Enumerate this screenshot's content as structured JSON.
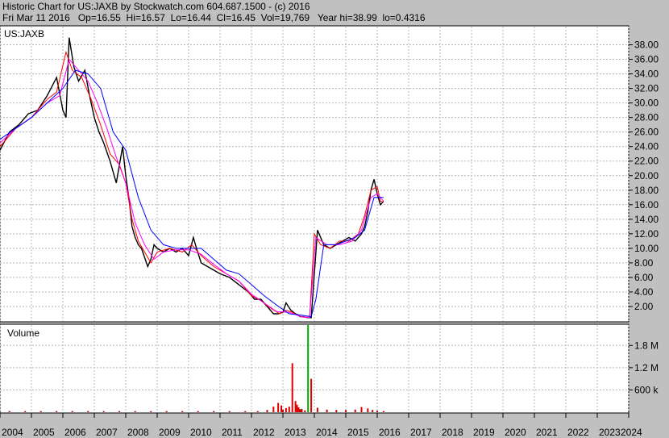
{
  "header": {
    "line1": "Historic Chart for US:JAXB by Stockwatch.com 604.687.1500 - (c) 2016",
    "line2": "Fri Mar 11 2016   Op=16.55  Hi=16.57  Lo=16.44  Cl=16.45  Vol=19,769   Year hi=38.99  lo=0.4316"
  },
  "chart_data": [
    {
      "type": "line",
      "label": "US:JAXB",
      "x_labels": [
        "2004",
        "2005",
        "2006",
        "2007",
        "2008",
        "2009",
        "2010",
        "2011",
        "2012",
        "2013",
        "2014",
        "2015",
        "2016",
        "2017",
        "2018",
        "2019",
        "2020",
        "2021",
        "2022",
        "2023",
        "2024"
      ],
      "y_ticks": [
        2,
        4,
        6,
        8,
        10,
        12,
        14,
        16,
        18,
        20,
        22,
        24,
        26,
        28,
        30,
        32,
        34,
        36,
        38
      ],
      "y_tick_labels": [
        "2.00",
        "4.00",
        "6.00",
        "8.00",
        "10.00",
        "12.00",
        "14.00",
        "16.00",
        "18.00",
        "20.00",
        "22.00",
        "24.00",
        "26.00",
        "28.00",
        "30.00",
        "32.00",
        "34.00",
        "36.00",
        "38.00"
      ],
      "ylim": [
        0,
        40.5
      ],
      "grid": true,
      "series": [
        {
          "color": "#000000",
          "x": [
            2004.0,
            2004.3,
            2004.6,
            2004.9,
            2005.2,
            2005.5,
            2005.8,
            2006.0,
            2006.1,
            2006.2,
            2006.35,
            2006.5,
            2006.7,
            2006.85,
            2007.0,
            2007.15,
            2007.3,
            2007.5,
            2007.7,
            2007.9,
            2008.0,
            2008.1,
            2008.2,
            2008.3,
            2008.4,
            2008.5,
            2008.7,
            2008.8,
            2008.9,
            2009.0,
            2009.2,
            2009.4,
            2009.6,
            2009.8,
            2010.0,
            2010.15,
            2010.25,
            2010.4,
            2010.6,
            2010.8,
            2011.0,
            2011.3,
            2011.6,
            2011.9,
            2012.1,
            2012.3,
            2012.5,
            2012.7,
            2012.85,
            2013.0,
            2013.1,
            2013.25,
            2013.4,
            2013.5,
            2013.55,
            2013.65,
            2013.75,
            2013.9,
            2014.1,
            2014.3,
            2014.5,
            2014.7,
            2014.9,
            2015.1,
            2015.3,
            2015.5,
            2015.6,
            2015.7,
            2015.8,
            2015.9,
            2016.0,
            2016.1,
            2016.2
          ],
          "y": [
            23.5,
            26.0,
            27.0,
            28.5,
            29.0,
            31.0,
            33.5,
            29.0,
            28.0,
            38.99,
            35.0,
            33.0,
            34.5,
            31.0,
            28.0,
            26.0,
            24.5,
            22.0,
            19.0,
            24.0,
            20.0,
            17.0,
            13.0,
            11.5,
            10.5,
            10.0,
            7.5,
            8.5,
            10.5,
            10.0,
            9.5,
            10.0,
            9.5,
            10.0,
            9.0,
            11.5,
            10.0,
            8.0,
            7.5,
            7.0,
            6.5,
            6.0,
            5.0,
            4.0,
            3.0,
            3.0,
            2.0,
            1.0,
            1.0,
            1.2,
            2.5,
            1.5,
            1.0,
            0.8,
            0.6,
            0.6,
            0.5,
            0.45,
            12.5,
            10.5,
            10.0,
            10.5,
            11.0,
            11.5,
            11.0,
            12.0,
            13.0,
            15.0,
            18.0,
            19.5,
            17.5,
            16.0,
            16.45
          ]
        },
        {
          "color": "#ff0000",
          "x": [
            2004.0,
            2004.5,
            2005.0,
            2005.5,
            2005.8,
            2006.1,
            2006.3,
            2006.6,
            2006.9,
            2007.2,
            2007.5,
            2007.8,
            2008.0,
            2008.2,
            2008.4,
            2008.6,
            2008.8,
            2009.0,
            2009.4,
            2009.8,
            2010.1,
            2010.4,
            2010.8,
            2011.2,
            2011.6,
            2012.0,
            2012.3,
            2012.6,
            2012.9,
            2013.1,
            2013.3,
            2013.5,
            2013.7,
            2013.85,
            2014.0,
            2014.2,
            2014.5,
            2014.8,
            2015.1,
            2015.4,
            2015.6,
            2015.8,
            2016.0,
            2016.1,
            2016.2
          ],
          "y": [
            24.0,
            26.5,
            28.0,
            30.5,
            31.5,
            37.0,
            34.5,
            33.5,
            30.5,
            27.0,
            23.0,
            21.5,
            19.0,
            14.0,
            11.0,
            9.5,
            8.0,
            9.5,
            10.0,
            9.5,
            10.5,
            9.0,
            7.5,
            6.5,
            5.5,
            3.5,
            2.8,
            1.8,
            1.0,
            1.5,
            1.2,
            0.7,
            0.5,
            0.5,
            12.0,
            10.5,
            10.0,
            11.0,
            11.0,
            12.0,
            14.5,
            18.0,
            18.5,
            16.5,
            16.4
          ]
        },
        {
          "color": "#ff00ff",
          "x": [
            2004.0,
            2004.5,
            2005.0,
            2005.5,
            2005.9,
            2006.2,
            2006.5,
            2006.8,
            2007.1,
            2007.4,
            2007.7,
            2008.0,
            2008.3,
            2008.6,
            2008.9,
            2009.2,
            2009.6,
            2010.0,
            2010.4,
            2010.8,
            2011.2,
            2011.6,
            2012.0,
            2012.4,
            2012.8,
            2013.2,
            2013.6,
            2013.85,
            2014.05,
            2014.4,
            2014.8,
            2015.2,
            2015.5,
            2015.8,
            2016.0,
            2016.2
          ],
          "y": [
            24.5,
            26.5,
            28.0,
            30.0,
            31.0,
            36.0,
            34.5,
            33.0,
            30.0,
            26.5,
            22.5,
            19.0,
            13.5,
            10.5,
            8.5,
            9.5,
            9.8,
            9.8,
            9.2,
            7.8,
            6.5,
            5.5,
            3.7,
            2.5,
            1.3,
            1.2,
            0.6,
            0.5,
            11.5,
            10.5,
            10.5,
            11.0,
            12.5,
            17.0,
            17.5,
            16.5
          ]
        },
        {
          "color": "#0000ff",
          "x": [
            2004.0,
            2004.5,
            2005.0,
            2005.5,
            2006.0,
            2006.4,
            2006.8,
            2007.2,
            2007.6,
            2008.0,
            2008.4,
            2008.8,
            2009.2,
            2009.6,
            2010.0,
            2010.4,
            2010.8,
            2011.2,
            2011.6,
            2012.0,
            2012.4,
            2012.8,
            2013.2,
            2013.6,
            2013.9,
            2014.05,
            2014.3,
            2014.7,
            2015.0,
            2015.3,
            2015.6,
            2015.9,
            2016.2
          ],
          "y": [
            25.0,
            26.5,
            28.0,
            30.0,
            32.0,
            34.5,
            34.0,
            32.0,
            26.0,
            23.5,
            17.0,
            12.5,
            10.5,
            10.0,
            10.0,
            10.0,
            8.5,
            7.0,
            6.5,
            5.0,
            3.5,
            2.2,
            1.0,
            0.8,
            0.6,
            3.0,
            10.5,
            10.5,
            11.0,
            11.5,
            12.5,
            17.0,
            17.0
          ]
        }
      ]
    },
    {
      "type": "bar",
      "label": "Volume",
      "y_ticks": [
        600000,
        1200000,
        1800000
      ],
      "y_tick_labels": [
        "600 k",
        "1.2 M",
        "1.8 M"
      ],
      "ylim": [
        0,
        2350000
      ],
      "series": [
        {
          "name": "Volume",
          "x": [
            2004.3,
            2004.8,
            2005.3,
            2005.8,
            2006.3,
            2006.8,
            2007.3,
            2007.8,
            2008.3,
            2008.8,
            2009.3,
            2009.8,
            2010.3,
            2010.8,
            2011.3,
            2011.8,
            2012.2,
            2012.5,
            2012.7,
            2012.85,
            2012.95,
            2013.0,
            2013.1,
            2013.2,
            2013.3,
            2013.4,
            2013.45,
            2013.5,
            2013.55,
            2013.6,
            2013.7,
            2013.8,
            2013.9,
            2014.1,
            2014.4,
            2014.7,
            2015.0,
            2015.3,
            2015.5,
            2015.7,
            2015.85,
            2016.0,
            2016.2
          ],
          "values": [
            30000,
            30000,
            30000,
            30000,
            30000,
            30000,
            30000,
            30000,
            30000,
            30000,
            30000,
            30000,
            30000,
            30000,
            30000,
            30000,
            30000,
            60000,
            150000,
            250000,
            180000,
            70000,
            110000,
            150000,
            1320000,
            300000,
            200000,
            130000,
            80000,
            90000,
            50000,
            2350000,
            900000,
            120000,
            70000,
            60000,
            60000,
            70000,
            140000,
            100000,
            60000,
            40000,
            30000
          ]
        }
      ]
    }
  ]
}
